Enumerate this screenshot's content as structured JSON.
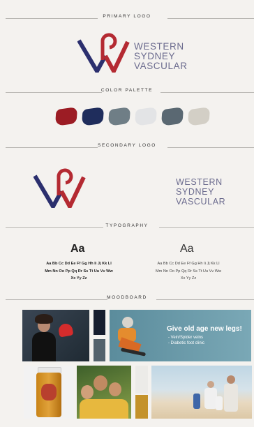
{
  "sections": {
    "primary_logo": "PRIMARY LOGO",
    "color_palette": "COLOR PALETTE",
    "secondary_logo": "SECONDARY LOGO",
    "typography": "TYPOGRAPHY",
    "moodboard": "MOODBOARD"
  },
  "logo": {
    "line1": "WESTERN",
    "line2": "SYDNEY",
    "line3": "VASCULAR",
    "colors": {
      "navy": "#2b2f6e",
      "red": "#b42a32",
      "text": "#6b6b8e"
    }
  },
  "palette": [
    "#9c1c24",
    "#1f2d5c",
    "#6f7e86",
    "#e3e4e6",
    "#5a6872",
    "#d3cfc6"
  ],
  "typography": {
    "bold": {
      "aa": "Aa",
      "line1": "Aa Bb Cc Dd Ee Ff Gg Hh Ii Jj Kk Ll",
      "line2": "Mm Nn Oo Pp Qq Rr Ss Tt Uu Vv Ww",
      "line3": "Xx Yy Zz"
    },
    "light": {
      "aa": "Aa",
      "line1": "Aa Bb Cc Dd Ee Ff Gg Hh Ii Jj Kk Ll",
      "line2": "Mm Nn Oo Pp Qq Rr Ss Tt Uu Vv Ww",
      "line3": "Xx Yy Zz"
    }
  },
  "moodboard": {
    "banner_headline": "Give old age new legs!",
    "banner_bullet1": "- Vein/Spider veins",
    "banner_bullet2": "- Diabetic foot clinic"
  }
}
